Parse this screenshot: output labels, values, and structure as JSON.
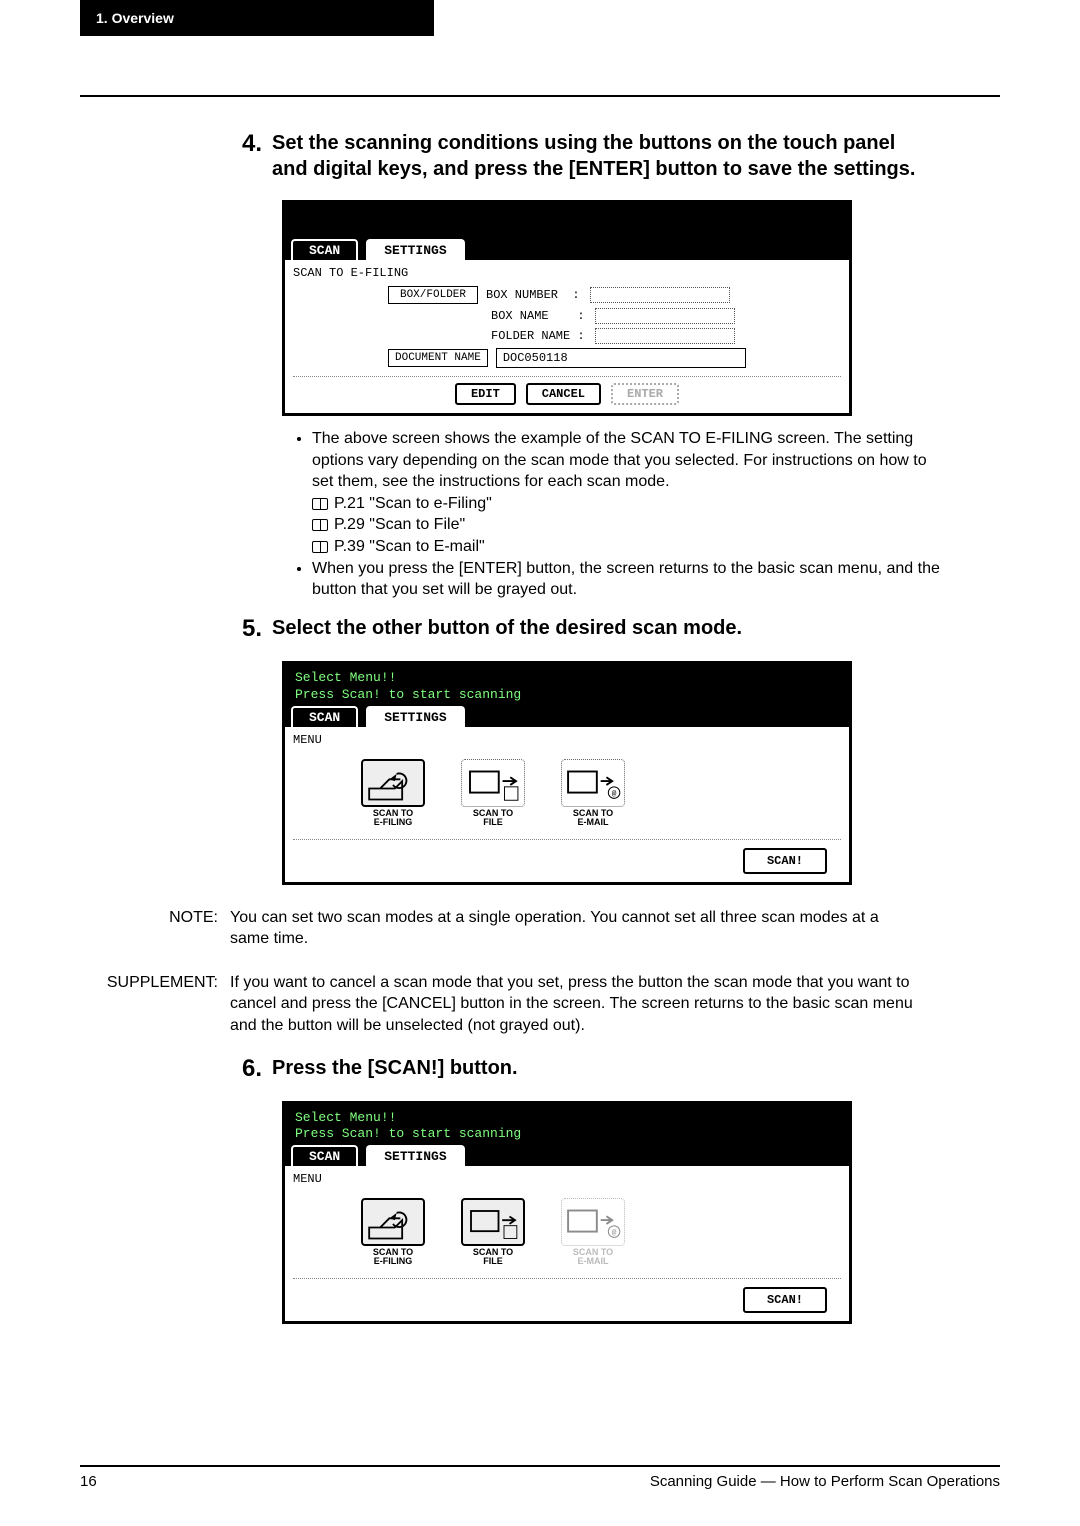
{
  "tab": {
    "label": "1. Overview"
  },
  "step4": {
    "num": "4.",
    "heading": "Set the scanning conditions using the buttons on the touch panel and digital keys, and press the [ENTER] button to save the settings.",
    "panel": {
      "tabs": {
        "scan": "SCAN",
        "settings": "SETTINGS"
      },
      "title": "SCAN TO E-FILING",
      "boxfolder_btn": "BOX/FOLDER",
      "boxnumber_label": "BOX NUMBER",
      "boxname_label": "BOX NAME",
      "foldername_label": "FOLDER NAME",
      "docname_btn": "DOCUMENT NAME",
      "docname_value": "DOC050118",
      "edit_btn": "EDIT",
      "cancel_btn": "CANCEL",
      "enter_btn": "ENTER"
    },
    "bullet1": "The above screen shows the example of the SCAN TO E-FILING screen. The setting options vary depending on the scan mode that you selected. For instructions on how to set them, see the instructions for each scan mode.",
    "ref1": "P.21 \"Scan to e-Filing\"",
    "ref2": "P.29 \"Scan to File\"",
    "ref3": "P.39 \"Scan to E-mail\"",
    "bullet2": "When you press the [ENTER] button, the screen returns to the basic scan menu, and the button that you set will be grayed out."
  },
  "step5": {
    "num": "5.",
    "heading": "Select the other button of the desired scan mode.",
    "panel": {
      "line1": "Select Menu!!",
      "line2": "Press Scan! to start scanning",
      "tabs": {
        "scan": "SCAN",
        "settings": "SETTINGS"
      },
      "menu_label": "MENU",
      "mode_efiling": "SCAN TO\nE-FILING",
      "mode_file": "SCAN TO\nFILE",
      "mode_email": "SCAN TO\nE-MAIL",
      "scan_btn": "SCAN!"
    }
  },
  "note": {
    "label": "NOTE:",
    "text": "You can set two scan modes at a single operation.  You cannot set all three scan modes at a same time."
  },
  "supplement": {
    "label": "SUPPLEMENT:",
    "text": "If you want to cancel a scan mode that you set, press the button the scan mode that you want to cancel and press the [CANCEL] button in the screen.  The screen returns to the basic scan menu and the button will be unselected (not grayed out)."
  },
  "step6": {
    "num": "6.",
    "heading": "Press the [SCAN!] button.",
    "panel": {
      "line1": "Select Menu!!",
      "line2": "Press Scan! to start scanning",
      "tabs": {
        "scan": "SCAN",
        "settings": "SETTINGS"
      },
      "menu_label": "MENU",
      "mode_efiling": "SCAN TO\nE-FILING",
      "mode_file": "SCAN TO\nFILE",
      "mode_email": "SCAN TO\nE-MAIL",
      "scan_btn": "SCAN!"
    }
  },
  "footer": {
    "page": "16",
    "title": "Scanning Guide — How to Perform Scan Operations"
  }
}
